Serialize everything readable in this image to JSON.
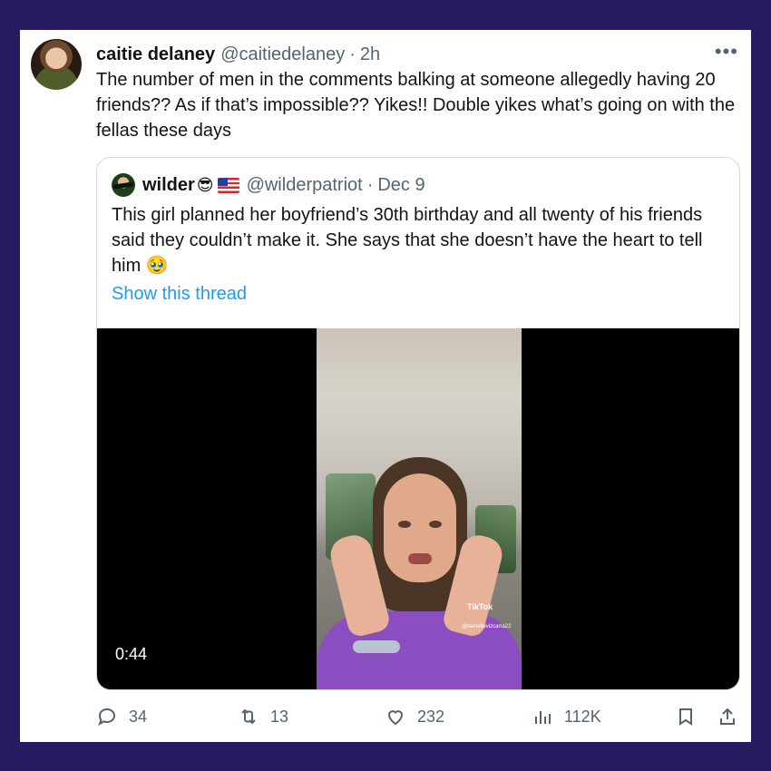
{
  "tweet": {
    "display_name": "caitie delaney",
    "handle": "@caitiedelaney",
    "separator": "·",
    "time": "2h",
    "more_icon": "more-horizontal-icon",
    "text": "The number of men in the comments balking at someone allegedly having 20 friends?? As if that’s impossible?? Yikes!! Double yikes what’s going on with the fellas these days"
  },
  "quote": {
    "display_name": "wilder",
    "emoji": "😎",
    "flag_icon": "us-flag-icon",
    "handle": "@wilderpatriot",
    "separator": "·",
    "time": "Dec 9",
    "text": "This girl planned her boyfriend’s 30th birthday and all twenty of his friends said they couldn’t make it. She says that she doesn’t have the heart to tell him 🥹",
    "show_thread": "Show this thread",
    "video": {
      "duration": "0:44",
      "watermark": "TikTok",
      "watermark_user": "@daniellevizcarra22"
    }
  },
  "actions": {
    "replies": "34",
    "retweets": "13",
    "likes": "232",
    "views": "112K"
  },
  "colors": {
    "background": "#251b60",
    "accent": "#1d9bf0",
    "muted": "#536471"
  }
}
